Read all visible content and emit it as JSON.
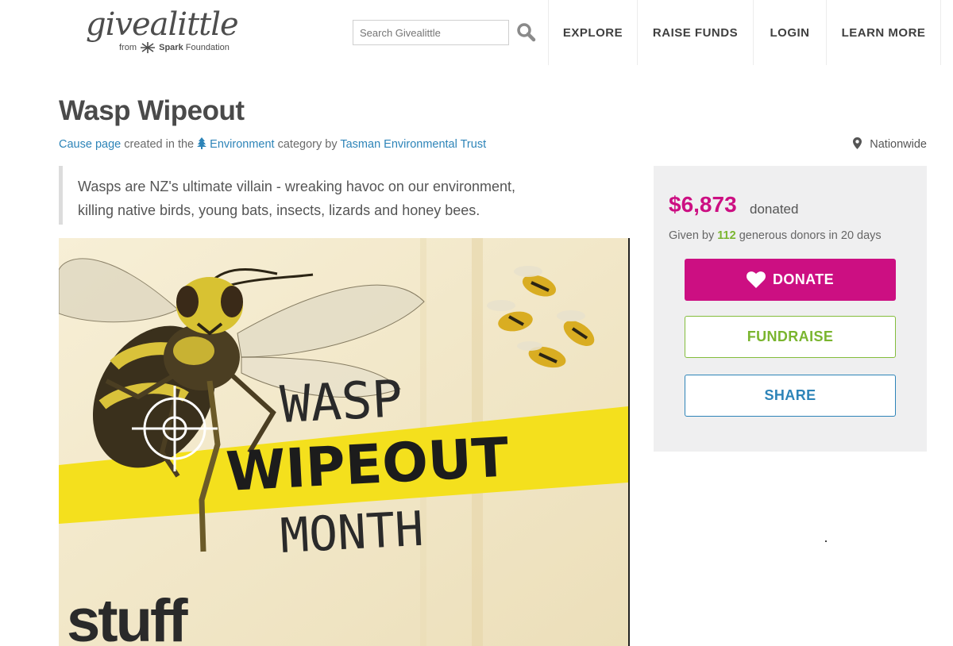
{
  "header": {
    "logo_word": "givealittle",
    "logo_from": "from",
    "logo_brand": "Spark",
    "logo_foundation": "Foundation",
    "search_placeholder": "Search Givealittle",
    "nav": [
      "EXPLORE",
      "RAISE FUNDS",
      "LOGIN",
      "LEARN MORE"
    ]
  },
  "page": {
    "title": "Wasp Wipeout",
    "meta": {
      "page_type": "Cause page",
      "created_in": "created in the",
      "category": "Environment",
      "category_suffix": "category by",
      "organisation": "Tasman Environmental Trust"
    },
    "location": "Nationwide",
    "summary": "Wasps are NZ's ultimate villain - wreaking havoc on our environment, killing native birds, young bats, insects, lizards and honey bees."
  },
  "hero": {
    "line1": "WASP",
    "line2": "WIPEOUT",
    "line3": "MONTH",
    "brand": "stuff"
  },
  "sidebar": {
    "amount": "$6,873",
    "amount_suffix": "donated",
    "donors_prefix": "Given by",
    "donor_count": "112",
    "donors_suffix": "generous donors in 20 days",
    "donate_label": "DONATE",
    "fundraise_label": "FUNDRAISE",
    "share_label": "SHARE"
  },
  "colors": {
    "brand_pink": "#cc0f82",
    "fundraise_green": "#7ab52f",
    "link_blue": "#2d84b8",
    "stripe_yellow": "#f4e01d"
  }
}
